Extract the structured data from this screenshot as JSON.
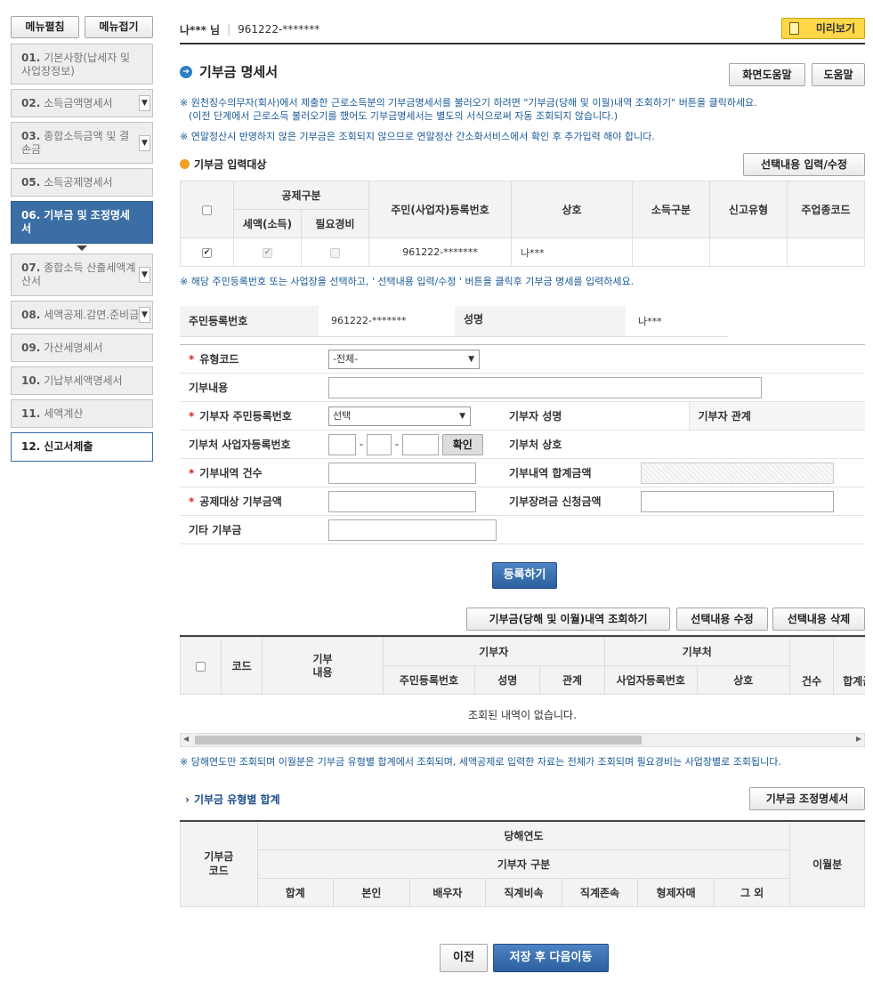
{
  "sidebar": {
    "expand_label": "메뉴펼침",
    "collapse_label": "메뉴접기",
    "items": [
      {
        "num": "01.",
        "label": "기본사항(납세자 및 사업장정보)"
      },
      {
        "num": "02.",
        "label": "소득금액명세서"
      },
      {
        "num": "03.",
        "label": "종합소득금액 및 결손금"
      },
      {
        "num": "05.",
        "label": "소득공제명세서"
      },
      {
        "num": "06.",
        "label": "기부금 및 조정명세서"
      },
      {
        "num": "07.",
        "label": "종합소득 산출세액계산서"
      },
      {
        "num": "08.",
        "label": "세액공제.감면.준비금"
      },
      {
        "num": "09.",
        "label": "가산세명세서"
      },
      {
        "num": "10.",
        "label": "기납부세액명세서"
      },
      {
        "num": "11.",
        "label": "세액계산"
      },
      {
        "num": "12.",
        "label": "신고서제출"
      }
    ]
  },
  "header": {
    "user_name": "나*** 님",
    "user_id": "961222-*******",
    "preview_label": "미리보기"
  },
  "page": {
    "title": "기부금 명세서",
    "help_screen_label": "화면도움말",
    "help_label": "도움말",
    "notes": [
      "※ 원천징수의무자(회사)에서 제출한 근로소득분의 기부금명세서를 불러오기 하려면 \"기부금(당해 및 이월)내역 조회하기\" 버튼을 클릭하세요.",
      "(이전 단계에서 근로소득 불러오기를 했어도 기부금명세서는 별도의 서식으로써 자동 조회되지 않습니다.)",
      "※ 연말정산시 반영하지 않은 기부금은 조회되지 않으므로 연말정산 간소화서비스에서 확인 후 추가입력 해야 합니다."
    ]
  },
  "target": {
    "title": "기부금 입력대상",
    "edit_button": "선택내용 입력/수정",
    "headers": {
      "deduction": "공제구분",
      "tax_credit": "세액(소득)",
      "expense": "필요경비",
      "reg_no": "주민(사업자)등록번호",
      "company": "상호",
      "income_type": "소득구분",
      "report_type": "신고유형",
      "industry": "주업종코드"
    },
    "row": {
      "reg_no": "961222-*******",
      "company": "나***"
    },
    "note": "※ 해당 주민등록번호 또는 사업장을 선택하고, ' 선택내용 입력/수정 ' 버튼을 클릭후 기부금 명세를 입력하세요."
  },
  "info": {
    "reg_label": "주민등록번호",
    "reg_value": "961222-*******",
    "name_label": "성명",
    "name_value": "나***"
  },
  "form": {
    "type_code": "유형코드",
    "type_value": "-전체-",
    "content": "기부내용",
    "donor_reg": "기부자 주민등록번호",
    "donor_reg_value": "선택",
    "donor_name": "기부자 성명",
    "donor_rel": "기부자 관계",
    "org_reg": "기부처 사업자등록번호",
    "confirm": "확인",
    "org_name": "기부처 상호",
    "count": "기부내역 건수",
    "total": "기부내역 합계금액",
    "target_amount": "공제대상 기부금액",
    "scholarship": "기부장려금 신청금액",
    "other": "기타 기부금",
    "register": "등록하기"
  },
  "list": {
    "query_button": "기부금(당해 및 이월)내역 조회하기",
    "edit_button": "선택내용 수정",
    "delete_button": "선택내용 삭제",
    "headers": {
      "code": "코드",
      "content": "기부\n내용",
      "donor": "기부자",
      "donor_reg": "주민등록번호",
      "donor_name": "성명",
      "donor_rel": "관계",
      "org": "기부처",
      "org_reg": "사업자등록번호",
      "org_name": "상호",
      "count": "건수",
      "total": "합계금액"
    },
    "empty": "조회된 내역이 없습니다.",
    "note": "※ 당해연도만 조회되며 이월분은 기부금 유형별 합계에서 조회되며, 세액공제로 입력한 자료는 전체가 조회되며 필요경비는 사업장별로 조회됩니다."
  },
  "summary": {
    "title": "기부금 유형별 합계",
    "adj_button": "기부금 조정명세서",
    "code": "기부금\n코드",
    "year": "당해연도",
    "donor_type": "기부자 구분",
    "carry": "이월분",
    "cols": [
      "합계",
      "본인",
      "배우자",
      "직계비속",
      "직계존속",
      "형제자매",
      "그 외"
    ]
  },
  "footer": {
    "prev": "이전",
    "next": "저장 후 다음이동"
  }
}
